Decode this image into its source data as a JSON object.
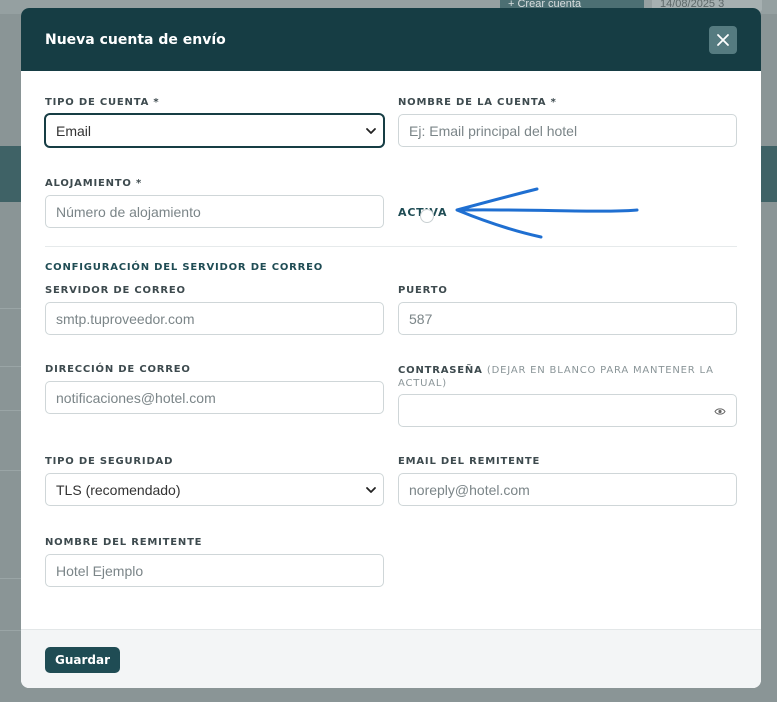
{
  "background": {
    "primary_button": "+ Crear cuenta",
    "secondary_button": "14/08/2025 3"
  },
  "modal": {
    "title": "Nueva cuenta de envío",
    "close_icon": "close-icon"
  },
  "form": {
    "account_type": {
      "label": "TIPO DE CUENTA *",
      "value": "Email"
    },
    "account_name": {
      "label": "NOMBRE DE LA CUENTA *",
      "placeholder": "Ej: Email principal del hotel"
    },
    "lodging": {
      "label": "ALOJAMIENTO *",
      "placeholder": "Número de alojamiento"
    },
    "active": {
      "label": "ACTIVA"
    },
    "server_section": {
      "title": "CONFIGURACIÓN DEL SERVIDOR DE CORREO"
    },
    "mail_server": {
      "label": "SERVIDOR DE CORREO",
      "placeholder": "smtp.tuproveedor.com"
    },
    "port": {
      "label": "PUERTO",
      "placeholder": "587"
    },
    "email_address": {
      "label": "DIRECCIÓN DE CORREO",
      "placeholder": "notificaciones@hotel.com"
    },
    "password": {
      "label": "CONTRASEÑA",
      "note": "(DEJAR EN BLANCO PARA MANTENER LA ACTUAL)",
      "icon": "eye-icon"
    },
    "security_type": {
      "label": "TIPO DE SEGURIDAD",
      "value": "TLS (recomendado)"
    },
    "sender_email": {
      "label": "EMAIL DEL REMITENTE",
      "placeholder": "noreply@hotel.com"
    },
    "sender_name": {
      "label": "NOMBRE DEL REMITENTE",
      "placeholder": "Hotel Ejemplo"
    }
  },
  "footer": {
    "save_label": "Guardar"
  },
  "colors": {
    "header_bg": "#163d44",
    "accent": "#1f4c54",
    "annotation_arrow": "#1f6fd1"
  }
}
